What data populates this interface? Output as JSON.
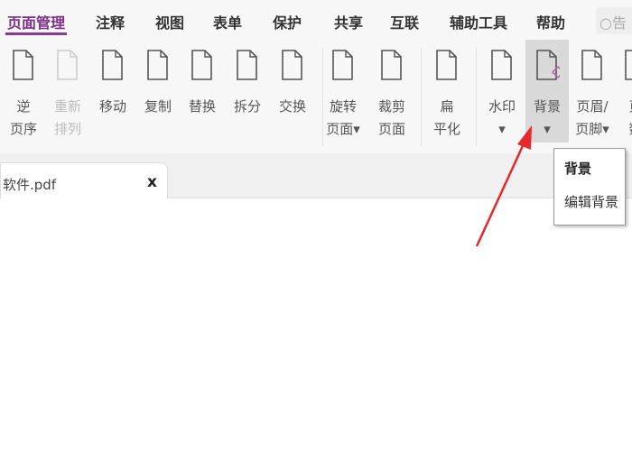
{
  "menu": [
    "页面管理",
    "注释",
    "视图",
    "表单",
    "保护",
    "共享",
    "互联",
    "辅助工具",
    "帮助"
  ],
  "search_placeholder": "告",
  "ribbon": [
    {
      "l1": "逆",
      "l2": "页序",
      "icon": "reverse-pages-icon"
    },
    {
      "l1": "重新",
      "l2": "排列",
      "icon": "reorder-icon",
      "disabled": true
    },
    {
      "l1": "移动",
      "l2": "",
      "icon": "move-icon"
    },
    {
      "l1": "复制",
      "l2": "",
      "icon": "copy-icon"
    },
    {
      "l1": "替换",
      "l2": "",
      "icon": "replace-icon"
    },
    {
      "l1": "拆分",
      "l2": "",
      "icon": "split-icon"
    },
    {
      "l1": "交换",
      "l2": "",
      "icon": "swap-icon"
    },
    {
      "l1": "旋转",
      "l2": "页面▾",
      "icon": "rotate-icon"
    },
    {
      "l1": "裁剪",
      "l2": "页面",
      "icon": "crop-icon"
    },
    {
      "l1": "扁",
      "l2": "平化",
      "icon": "flatten-icon"
    },
    {
      "l1": "水印",
      "l2": "▾",
      "icon": "watermark-icon"
    },
    {
      "l1": "背景",
      "l2": "▾",
      "icon": "background-icon",
      "selected": true
    },
    {
      "l1": "页眉/",
      "l2": "页脚▾",
      "icon": "header-footer-icon"
    },
    {
      "l1": "页",
      "l2": "数",
      "icon": "page-number-icon"
    }
  ],
  "doc_tab": {
    "name": "软件.pdf",
    "close": "x"
  },
  "tooltip": {
    "title": "背景",
    "desc": "编辑背景"
  },
  "colors": {
    "accent": "#7b2f86",
    "arrow": "#e8282b"
  }
}
